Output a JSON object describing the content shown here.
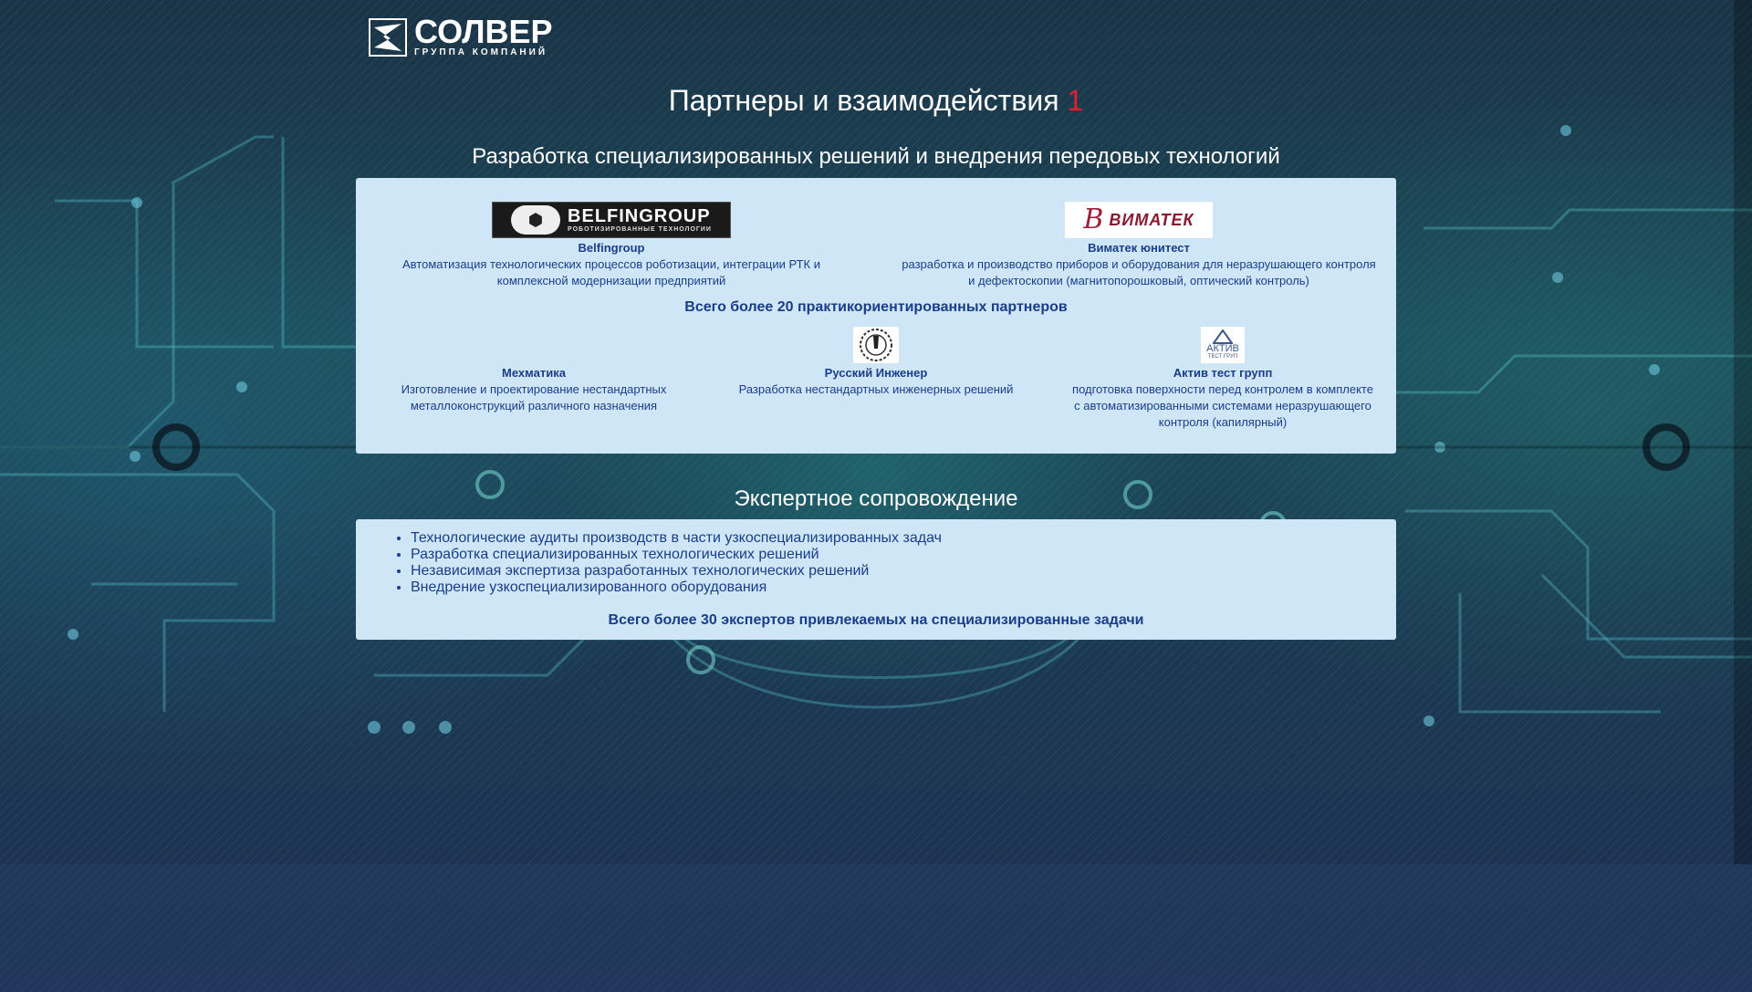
{
  "header": {
    "brand_name": "СОЛВЕР",
    "brand_sub": "ГРУППА КОМПАНИЙ"
  },
  "page": {
    "title": "Партнеры и взаимодействия",
    "title_number": "1"
  },
  "partners_section": {
    "title": "Разработка специализированных решений и внедрения передовых технологий",
    "top_partners": [
      {
        "logo_text": "BELFINGROUP",
        "logo_subtext": "РОБОТИЗИРОВАННЫЕ ТЕХНОЛОГИИ",
        "logo_icon": "belfingroup-logo-icon",
        "name": "Belfingroup",
        "description": "Автоматизация технологических процессов роботизации, интеграции РТК и комплексной модернизации предприятий"
      },
      {
        "logo_text": "ВИМАТЕК",
        "logo_icon": "vimatek-logo-icon",
        "name": "Виматек юнитест",
        "description": "разработка и производство приборов и оборудования для неразрушающего контроля и дефектоскопии (магнитопорошковый, оптический контроль)"
      }
    ],
    "total_text": "Всего более 20 практикориентированных партнеров",
    "bottom_partners": [
      {
        "name": "Мехматика",
        "description": "Изготовление и проектирование нестандартных металлоконструкций различного назначения"
      },
      {
        "logo_icon": "russian-engineer-logo-icon",
        "name": "Русский Инженер",
        "description": "Разработка нестандартных инженерных решений"
      },
      {
        "logo_text": "АКТИВ",
        "logo_subtext": "ТЕСТ ГРУП",
        "logo_icon": "aktiv-test-logo-icon",
        "name": "Актив тест групп",
        "description": "подготовка поверхности перед контролем в комплекте с автоматизированными системами неразрушающего контроля (капилярный)"
      }
    ]
  },
  "expert_section": {
    "title": "Экспертное сопровождение",
    "items": [
      "Технологические аудиты производств в части узкоспециализированных задач",
      "Разработка специализированных технологических решений",
      "Независимая экспертиза разработанных технологических решений",
      "Внедрение узкоспециализированного оборудования"
    ],
    "total_text": "Всего более 30 экспертов привлекаемых на специализированные задачи"
  },
  "colors": {
    "panel_bg": "#cfe6f7",
    "panel_text": "#1a3d8a",
    "title_accent": "#e02030"
  }
}
